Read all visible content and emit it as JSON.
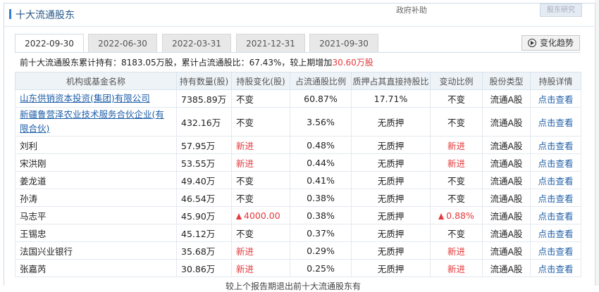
{
  "header": {
    "title": "十大流通股东",
    "right_text": "政府补助",
    "right_button": "股东研究"
  },
  "tabs": [
    "2022-09-30",
    "2022-06-30",
    "2022-03-31",
    "2021-12-31",
    "2021-09-30"
  ],
  "active_tab": 0,
  "trend_button": "变化趋势",
  "summary": {
    "prefix": "前十大流通股东累计持有：",
    "holding": "8183.05万股",
    "ratio_label": "，累计占流通股比：",
    "ratio": "67.43%",
    "change_label": "，较上期增加",
    "change_value": "30.60万股"
  },
  "columns": [
    "机构或基金名称",
    "持有数量(股)",
    "持股变化(股)",
    "占流通股比例",
    "质押占其直接持股比",
    "变动比例",
    "股份类型",
    "持股详情"
  ],
  "rows": [
    {
      "name": "山东供销资本投资(集团)有限公司",
      "link": true,
      "qty": "7385.89万",
      "change": "不变",
      "change_type": "flat",
      "ratio": "60.87%",
      "pledge": "17.71%",
      "var": "不变",
      "var_type": "flat",
      "type": "流通A股",
      "detail": "点击查看"
    },
    {
      "name": "新疆鲁营泽农业技术服务合伙企业(有限合伙)",
      "link": true,
      "qty": "432.16万",
      "change": "不变",
      "change_type": "flat",
      "ratio": "3.56%",
      "pledge": "无质押",
      "var": "不变",
      "var_type": "flat",
      "type": "流通A股",
      "detail": "点击查看"
    },
    {
      "name": "刘利",
      "link": false,
      "qty": "57.95万",
      "change": "新进",
      "change_type": "new",
      "ratio": "0.48%",
      "pledge": "无质押",
      "var": "新进",
      "var_type": "new",
      "type": "流通A股",
      "detail": "点击查看"
    },
    {
      "name": "宋洪刚",
      "link": false,
      "qty": "53.55万",
      "change": "新进",
      "change_type": "new",
      "ratio": "0.44%",
      "pledge": "无质押",
      "var": "新进",
      "var_type": "new",
      "type": "流通A股",
      "detail": "点击查看"
    },
    {
      "name": "姜龙道",
      "link": false,
      "qty": "49.40万",
      "change": "不变",
      "change_type": "flat",
      "ratio": "0.41%",
      "pledge": "无质押",
      "var": "不变",
      "var_type": "flat",
      "type": "流通A股",
      "detail": "点击查看"
    },
    {
      "name": "孙涛",
      "link": false,
      "qty": "46.54万",
      "change": "不变",
      "change_type": "flat",
      "ratio": "0.38%",
      "pledge": "无质押",
      "var": "不变",
      "var_type": "flat",
      "type": "流通A股",
      "detail": "点击查看"
    },
    {
      "name": "马志平",
      "link": false,
      "qty": "45.90万",
      "change": "4000.00",
      "change_type": "up",
      "ratio": "0.38%",
      "pledge": "无质押",
      "var": "0.88%",
      "var_type": "up",
      "type": "流通A股",
      "detail": "点击查看"
    },
    {
      "name": "王锡忠",
      "link": false,
      "qty": "45.12万",
      "change": "不变",
      "change_type": "flat",
      "ratio": "0.37%",
      "pledge": "无质押",
      "var": "不变",
      "var_type": "flat",
      "type": "流通A股",
      "detail": "点击查看"
    },
    {
      "name": "法国兴业银行",
      "link": false,
      "qty": "35.68万",
      "change": "新进",
      "change_type": "new",
      "ratio": "0.29%",
      "pledge": "无质押",
      "var": "新进",
      "var_type": "new",
      "type": "流通A股",
      "detail": "点击查看"
    },
    {
      "name": "张嘉芮",
      "link": false,
      "qty": "30.86万",
      "change": "新进",
      "change_type": "new",
      "ratio": "0.25%",
      "pledge": "无质押",
      "var": "新进",
      "var_type": "new",
      "type": "流通A股",
      "detail": "点击查看"
    }
  ],
  "footer_note": "较上个报告期退出前十大流通股东有",
  "colors": {
    "accent": "#2f7ed8",
    "link": "#1f5fa8",
    "red": "#e4393c",
    "header_bg": "#eef3f8"
  }
}
